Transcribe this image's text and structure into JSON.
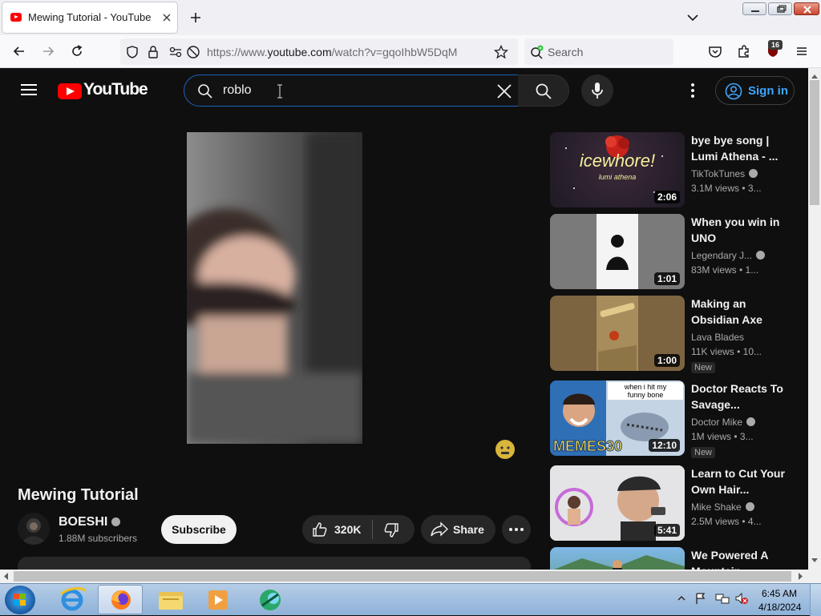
{
  "browser": {
    "tab_title": "Mewing Tutorial - YouTube",
    "url_prefix": "https://www.",
    "url_domain": "youtube.com",
    "url_path": "/watch?v=gqoIhbW5DqM",
    "search_placeholder": "Search",
    "extension_badge": "16"
  },
  "youtube": {
    "logo_text": "YouTube",
    "search_value": "roblo",
    "signin_label": "Sign in"
  },
  "video": {
    "title": "Mewing Tutorial",
    "channel": "BOESHI",
    "subscribers": "1.88M subscribers",
    "subscribe_label": "Subscribe",
    "likes": "320K",
    "share_label": "Share"
  },
  "recommendations": [
    {
      "title": "bye bye song | Lumi Athena - ...",
      "channel": "TikTokTunes",
      "meta": "3.1M views • 3...",
      "duration": "2:06",
      "new": "",
      "thumb_text": "icewhore!",
      "thumb_sub": "lumi athena"
    },
    {
      "title": "When you win in UNO",
      "channel": "Legendary J...",
      "meta": "83M views • 1...",
      "duration": "1:01",
      "new": ""
    },
    {
      "title": "Making an Obsidian Axe",
      "channel": "Lava Blades",
      "meta": "11K views • 10...",
      "duration": "1:00",
      "new": "New"
    },
    {
      "title": "Doctor Reacts To Savage...",
      "channel": "Doctor Mike",
      "meta": "1M views • 3...",
      "duration": "12:10",
      "new": "New",
      "thumb_caption": "when i hit my funny bone",
      "thumb_badge": "MEMES30"
    },
    {
      "title": "Learn to Cut Your Own Hair...",
      "channel": "Mike Shake",
      "meta": "2.5M views • 4...",
      "duration": "5:41",
      "new": ""
    },
    {
      "title": "We Powered A Mountain...",
      "channel": "",
      "meta": "",
      "duration": "",
      "new": ""
    }
  ],
  "taskbar": {
    "time": "6:45 AM",
    "date": "4/18/2024"
  },
  "colors": {
    "yt_red": "#ff0000",
    "link_blue": "#3ea6ff",
    "bg_dark": "#0f0f0f"
  }
}
